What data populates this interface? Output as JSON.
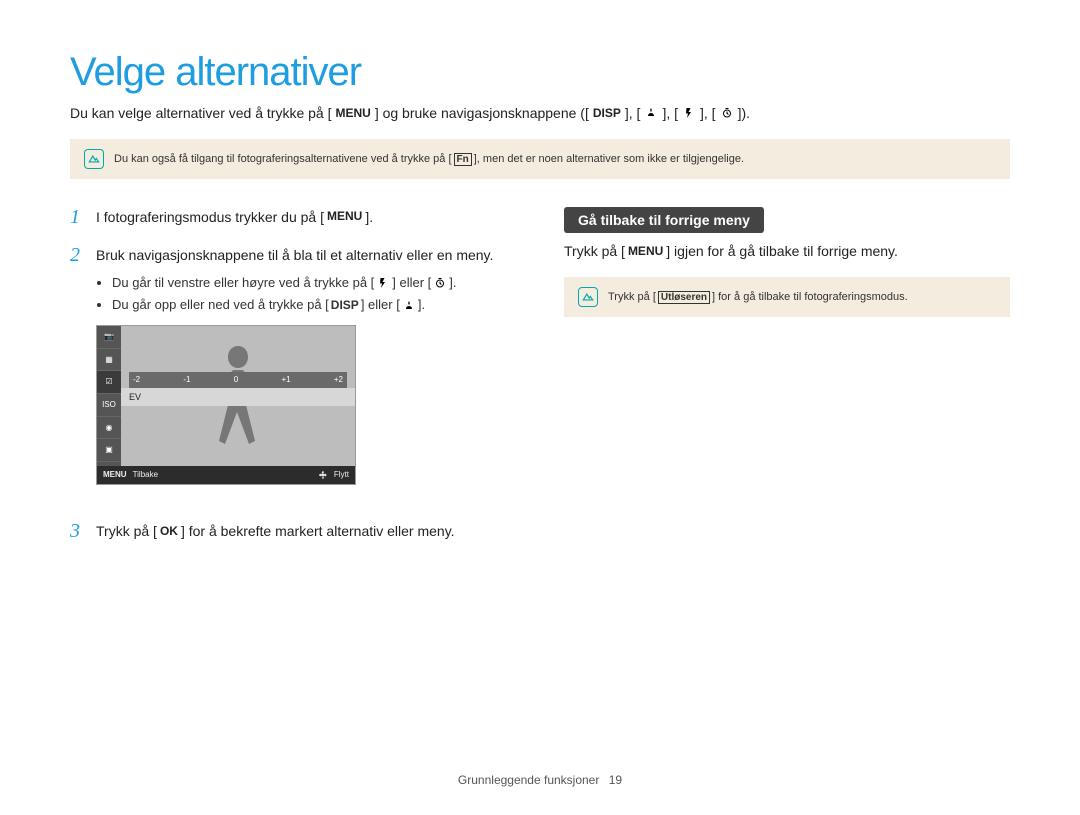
{
  "title": "Velge alternativer",
  "intro": {
    "pre": "Du kan velge alternativer ved å trykke på [",
    "menu": "MENU",
    "mid": "] og bruke navigasjonsknappene ([",
    "disp": "DISP",
    "sep": "], [",
    "end": "])."
  },
  "note1": {
    "pre": "Du kan også få tilgang til fotograferingsalternativene ved å trykke på [",
    "fn": "Fn",
    "post": "], men det er noen alternativer som ikke er tilgjengelige."
  },
  "steps": {
    "s1": {
      "num": "1",
      "pre": "I fotograferingsmodus trykker du på [",
      "menu": "MENU",
      "post": "]."
    },
    "s2": {
      "num": "2",
      "text": "Bruk navigasjonsknappene til å bla til et alternativ eller en meny.",
      "b1": {
        "pre": "Du går til venstre eller høyre ved å trykke på [",
        "mid": "] eller [",
        "post": "]."
      },
      "b2": {
        "pre": "Du går opp eller ned ved å trykke på [",
        "disp": "DISP",
        "mid": "] eller [",
        "post": "]."
      }
    },
    "s3": {
      "num": "3",
      "pre": "Trykk på [",
      "ok": "OK",
      "post": "] for å bekrefte markert alternativ eller meny."
    }
  },
  "lcd": {
    "ev_ticks": [
      "-2",
      "-1",
      "0",
      "+1",
      "+2"
    ],
    "ev_label": "EV",
    "foot_menu": "MENU",
    "foot_back": "Tilbake",
    "foot_move": "Flytt"
  },
  "right": {
    "header": "Gå tilbake til forrige meny",
    "line": {
      "pre": "Trykk på [",
      "menu": "MENU",
      "post": "] igjen for å gå tilbake til forrige meny."
    },
    "note": {
      "pre": "Trykk på [",
      "shutter": "Utløseren",
      "post": "] for å gå tilbake til fotograferingsmodus."
    }
  },
  "footer": {
    "section": "Grunnleggende funksjoner",
    "page": "19"
  }
}
